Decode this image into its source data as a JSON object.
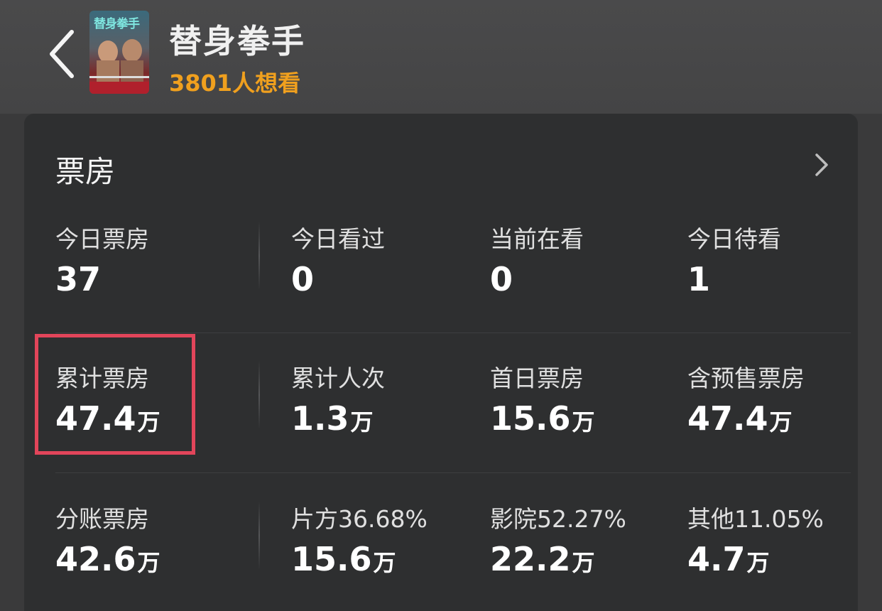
{
  "header": {
    "back_icon": "chevron-left-icon",
    "poster_text": "替身拳手",
    "title": "替身拳手",
    "want_count": "3801",
    "want_suffix": "人想看"
  },
  "card": {
    "title": "票房",
    "more_icon": "chevron-right-icon",
    "rows": [
      [
        {
          "label": "今日票房",
          "value": "37",
          "unit": ""
        },
        {
          "label": "今日看过",
          "value": "0",
          "unit": ""
        },
        {
          "label": "当前在看",
          "value": "0",
          "unit": ""
        },
        {
          "label": "今日待看",
          "value": "1",
          "unit": ""
        }
      ],
      [
        {
          "label": "累计票房",
          "value": "47.4",
          "unit": "万"
        },
        {
          "label": "累计人次",
          "value": "1.3",
          "unit": "万"
        },
        {
          "label": "首日票房",
          "value": "15.6",
          "unit": "万"
        },
        {
          "label": "含预售票房",
          "value": "47.4",
          "unit": "万"
        }
      ],
      [
        {
          "label": "分账票房",
          "value": "42.6",
          "unit": "万"
        },
        {
          "label": "片方36.68%",
          "value": "15.6",
          "unit": "万"
        },
        {
          "label": "影院52.27%",
          "value": "22.2",
          "unit": "万"
        },
        {
          "label": "其他11.05%",
          "value": "4.7",
          "unit": "万"
        }
      ]
    ]
  },
  "colors": {
    "accent": "#f0a01e",
    "highlight": "#e2455a",
    "card_bg": "#2e2f30",
    "header_bg": "#4a4a4b"
  }
}
